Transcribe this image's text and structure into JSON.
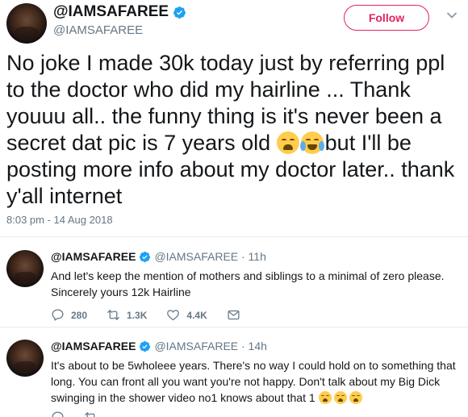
{
  "main_tweet": {
    "display_name": "@IAMSAFAREE",
    "handle": "@IAMSAFAREE",
    "follow_label": "Follow",
    "text_parts": [
      "No joke I made 30k today just by referring ppl to the doctor who did my hairline ... Thank youuu all.. the funny thing is it's never been a secret dat pic is 7 years old ",
      "but I'll be posting more info about my doctor later.. thank y'all internet"
    ],
    "emojis": [
      "weary-face-emoji",
      "face-with-tears-of-joy-emoji"
    ],
    "timestamp": "8:03 pm - 14 Aug 2018"
  },
  "replies": [
    {
      "display_name": "@IAMSAFAREE",
      "meta": "@IAMSAFAREE · 11h",
      "text": "And let's keep the mention of mothers and siblings to a minimal of zero please. Sincerely yours 12k Hairline",
      "replies_count": "280",
      "retweets_count": "1.3K",
      "likes_count": "4.4K"
    },
    {
      "display_name": "@IAMSAFAREE",
      "meta": "@IAMSAFAREE · 14h",
      "text": "It's about to be 5wholeee years. There's no way I could hold on to something that long. You can front all you want you're not happy. Don't talk about my Big Dick swinging in the shower video no1 knows about that 1 ",
      "trailing_emojis": [
        "weary-face-emoji",
        "weary-face-emoji",
        "weary-face-emoji"
      ]
    }
  ],
  "colors": {
    "follow_accent": "#e0245e",
    "verified_blue": "#1da1f2",
    "secondary_text": "#657786"
  }
}
